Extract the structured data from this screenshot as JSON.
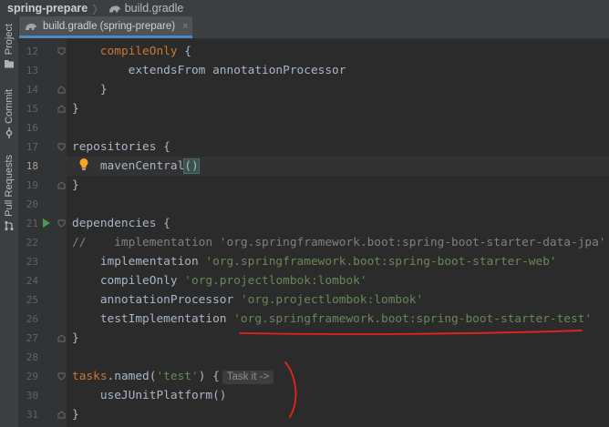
{
  "breadcrumb": {
    "project": "spring-prepare",
    "file": "build.gradle"
  },
  "tab": {
    "label": "build.gradle (spring-prepare)",
    "close": "×"
  },
  "sidebar": {
    "items": [
      "Project",
      "Commit",
      "Pull Requests"
    ]
  },
  "editor": {
    "current_line": "18",
    "inlay_hint": "Task it ->",
    "lines": [
      {
        "n": "12",
        "t": [
          [
            "    ",
            ""
          ],
          [
            "compileOnly",
            ""
          ],
          [
            " {",
            ""
          ]
        ]
      },
      {
        "n": "13",
        "t": [
          [
            "        extendsFrom annotationProcessor",
            ""
          ]
        ]
      },
      {
        "n": "14",
        "t": [
          [
            "    }",
            ""
          ]
        ]
      },
      {
        "n": "15",
        "t": [
          [
            "}",
            ""
          ]
        ]
      },
      {
        "n": "16",
        "t": []
      },
      {
        "n": "17",
        "t": [
          [
            "repositories {",
            ""
          ]
        ]
      },
      {
        "n": "18",
        "t": [
          [
            "    mavenCentral",
            ""
          ],
          [
            "()",
            "brk"
          ]
        ]
      },
      {
        "n": "19",
        "t": [
          [
            "}",
            ""
          ]
        ]
      },
      {
        "n": "20",
        "t": []
      },
      {
        "n": "21",
        "t": [
          [
            "dependencies {",
            ""
          ]
        ]
      },
      {
        "n": "22",
        "t": [
          [
            "//    implementation 'org.springframework.boot:spring-boot-starter-data-jpa'",
            "cmt"
          ]
        ]
      },
      {
        "n": "23",
        "t": [
          [
            "    implementation ",
            ""
          ],
          [
            "'org.springframework.boot:spring-boot-starter-web'",
            "str"
          ]
        ]
      },
      {
        "n": "24",
        "t": [
          [
            "    compileOnly ",
            ""
          ],
          [
            "'org.projectlombok:lombok'",
            "str"
          ]
        ]
      },
      {
        "n": "25",
        "t": [
          [
            "    annotationProcessor ",
            ""
          ],
          [
            "'org.projectlombok:lombok'",
            "str"
          ]
        ]
      },
      {
        "n": "26",
        "t": [
          [
            "    testImplementation ",
            ""
          ],
          [
            "'org.springframework.boot:spring-boot-starter-test'",
            "str"
          ]
        ]
      },
      {
        "n": "27",
        "t": [
          [
            "}",
            ""
          ]
        ]
      },
      {
        "n": "28",
        "t": []
      },
      {
        "n": "29",
        "t": [
          [
            "tasks",
            ""
          ],
          [
            ".named(",
            ""
          ],
          [
            "'test'",
            "str"
          ],
          [
            ") {",
            ""
          ]
        ]
      },
      {
        "n": "30",
        "t": [
          [
            "    useJUnitPlatform()",
            ""
          ]
        ]
      },
      {
        "n": "31",
        "t": [
          [
            "}",
            ""
          ]
        ]
      }
    ]
  },
  "colors": {
    "background": "#2b2b2b",
    "gutter": "#313335",
    "string": "#6a8759",
    "comment": "#808080",
    "annotation": "#e8221d",
    "run": "#499c54"
  },
  "icons": [
    "gradle-icon",
    "folder-icon",
    "commit-icon",
    "pull-request-icon",
    "bulb-icon",
    "run-gutter-icon",
    "fold-icon"
  ]
}
